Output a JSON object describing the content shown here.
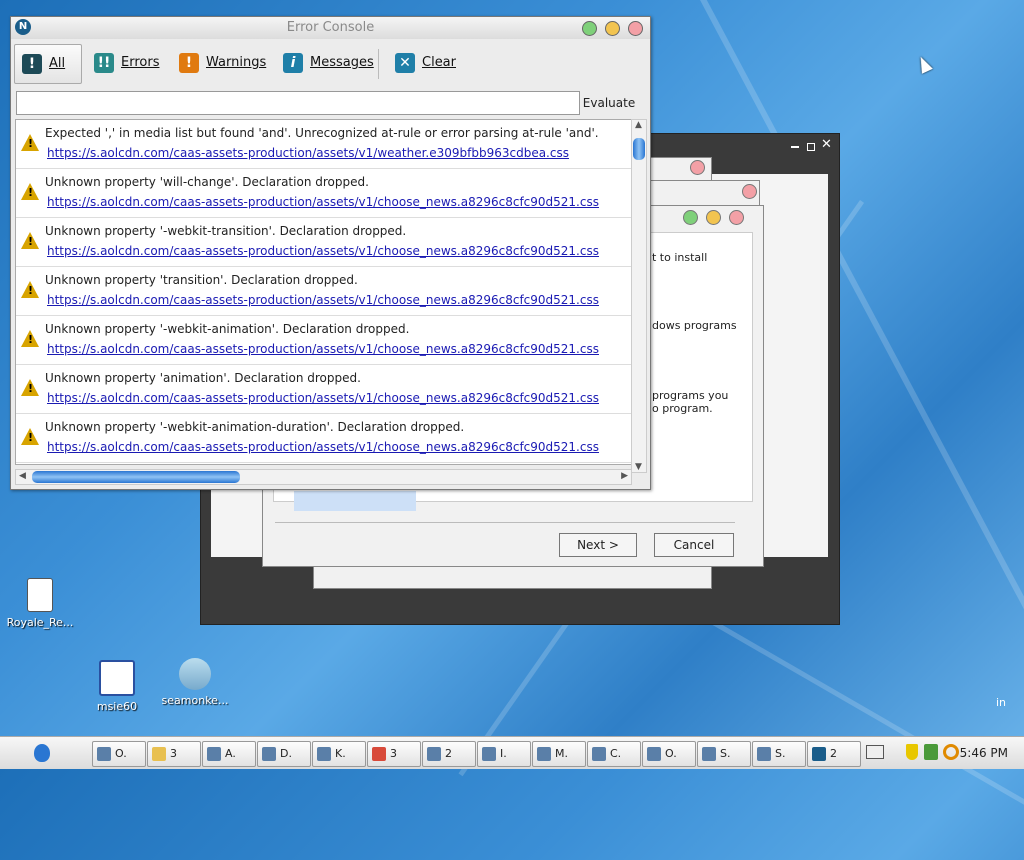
{
  "colors": {
    "accent": "#2a76d2",
    "warning": "#d8a400",
    "link": "#1a1ab3"
  },
  "desktop": {
    "icons": [
      {
        "label": "Royale_Re...",
        "icon": "file-icon"
      },
      {
        "label": "msie60",
        "icon": "window-icon"
      },
      {
        "label": "seamonke...",
        "icon": "installer-icon"
      }
    ],
    "corner_text": "in"
  },
  "background_window": {
    "text_1": "t to install",
    "text_2": "dows programs",
    "text_3": "programs you",
    "text_4": "o program.",
    "next_label": "Next >",
    "cancel_label": "Cancel"
  },
  "console": {
    "title": "Error Console",
    "toolbar": {
      "all": "All",
      "errors": "Errors",
      "warnings": "Warnings",
      "messages": "Messages",
      "clear": "Clear"
    },
    "evaluate_label": "Evaluate",
    "evaluate_value": "",
    "messages": [
      {
        "text": "Expected ',' in media list but found 'and'. Unrecognized at-rule or error parsing at-rule 'and'.",
        "source": "https://s.aolcdn.com/caas-assets-production/assets/v1/weather.e309bfbb963cdbea.css"
      },
      {
        "text": "Unknown property 'will-change'. Declaration dropped.",
        "source": "https://s.aolcdn.com/caas-assets-production/assets/v1/choose_news.a8296c8cfc90d521.css"
      },
      {
        "text": "Unknown property '-webkit-transition'. Declaration dropped.",
        "source": "https://s.aolcdn.com/caas-assets-production/assets/v1/choose_news.a8296c8cfc90d521.css"
      },
      {
        "text": "Unknown property 'transition'. Declaration dropped.",
        "source": "https://s.aolcdn.com/caas-assets-production/assets/v1/choose_news.a8296c8cfc90d521.css"
      },
      {
        "text": "Unknown property '-webkit-animation'. Declaration dropped.",
        "source": "https://s.aolcdn.com/caas-assets-production/assets/v1/choose_news.a8296c8cfc90d521.css"
      },
      {
        "text": "Unknown property 'animation'. Declaration dropped.",
        "source": "https://s.aolcdn.com/caas-assets-production/assets/v1/choose_news.a8296c8cfc90d521.css"
      },
      {
        "text": "Unknown property '-webkit-animation-duration'. Declaration dropped.",
        "source": "https://s.aolcdn.com/caas-assets-production/assets/v1/choose_news.a8296c8cfc90d521.css"
      }
    ]
  },
  "taskbar": {
    "tasks": [
      {
        "label": "O.",
        "icon": "app-icon"
      },
      {
        "label": "3",
        "icon": "folder-icon"
      },
      {
        "label": "A.",
        "icon": "app-icon"
      },
      {
        "label": "D.",
        "icon": "app-icon"
      },
      {
        "label": "K.",
        "icon": "app-icon"
      },
      {
        "label": "3",
        "icon": "chrome-icon"
      },
      {
        "label": "2",
        "icon": "app-icon"
      },
      {
        "label": "I.",
        "icon": "app-icon"
      },
      {
        "label": "M.",
        "icon": "app-icon"
      },
      {
        "label": "C.",
        "icon": "app-icon"
      },
      {
        "label": "O.",
        "icon": "app-icon"
      },
      {
        "label": "S.",
        "icon": "app-icon"
      },
      {
        "label": "S.",
        "icon": "app-icon"
      },
      {
        "label": "2",
        "icon": "netscape-icon"
      }
    ],
    "clock": "5:46 PM"
  }
}
